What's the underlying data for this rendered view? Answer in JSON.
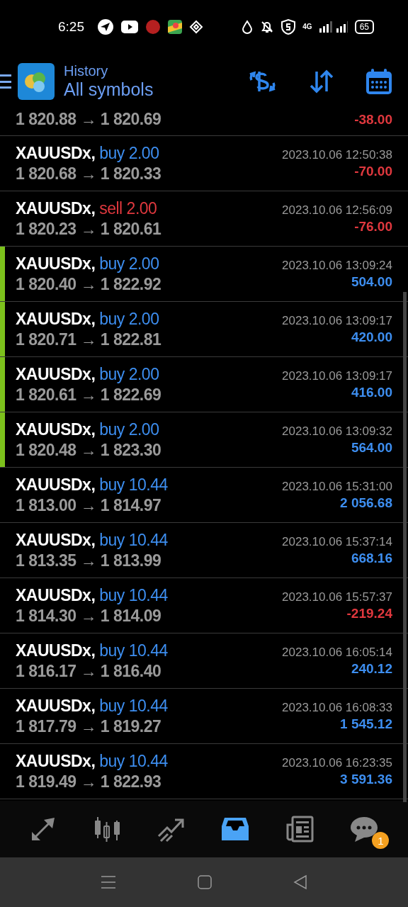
{
  "status_bar": {
    "time": "6:25",
    "network": "4G",
    "battery": "65"
  },
  "header": {
    "title": "History",
    "subtitle": "All symbols"
  },
  "partial_row": {
    "prices": "1 820.88 → 1 820.69",
    "profit": "-38.00",
    "loss": true
  },
  "trades": [
    {
      "symbol": "XAUUSDx,",
      "side": "buy",
      "volume": "2.00",
      "time": "2023.10.06 12:50:38",
      "prices": "1 820.68 → 1 820.33",
      "profit": "-70.00",
      "loss": true,
      "highlighted": false
    },
    {
      "symbol": "XAUUSDx,",
      "side": "sell",
      "volume": "2.00",
      "time": "2023.10.06 12:56:09",
      "prices": "1 820.23 → 1 820.61",
      "profit": "-76.00",
      "loss": true,
      "highlighted": false
    },
    {
      "symbol": "XAUUSDx,",
      "side": "buy",
      "volume": "2.00",
      "time": "2023.10.06 13:09:24",
      "prices": "1 820.40 → 1 822.92",
      "profit": "504.00",
      "loss": false,
      "highlighted": true
    },
    {
      "symbol": "XAUUSDx,",
      "side": "buy",
      "volume": "2.00",
      "time": "2023.10.06 13:09:17",
      "prices": "1 820.71 → 1 822.81",
      "profit": "420.00",
      "loss": false,
      "highlighted": true
    },
    {
      "symbol": "XAUUSDx,",
      "side": "buy",
      "volume": "2.00",
      "time": "2023.10.06 13:09:17",
      "prices": "1 820.61 → 1 822.69",
      "profit": "416.00",
      "loss": false,
      "highlighted": true
    },
    {
      "symbol": "XAUUSDx,",
      "side": "buy",
      "volume": "2.00",
      "time": "2023.10.06 13:09:32",
      "prices": "1 820.48 → 1 823.30",
      "profit": "564.00",
      "loss": false,
      "highlighted": true
    },
    {
      "symbol": "XAUUSDx,",
      "side": "buy",
      "volume": "10.44",
      "time": "2023.10.06 15:31:00",
      "prices": "1 813.00 → 1 814.97",
      "profit": "2 056.68",
      "loss": false,
      "highlighted": false
    },
    {
      "symbol": "XAUUSDx,",
      "side": "buy",
      "volume": "10.44",
      "time": "2023.10.06 15:37:14",
      "prices": "1 813.35 → 1 813.99",
      "profit": "668.16",
      "loss": false,
      "highlighted": false
    },
    {
      "symbol": "XAUUSDx,",
      "side": "buy",
      "volume": "10.44",
      "time": "2023.10.06 15:57:37",
      "prices": "1 814.30 → 1 814.09",
      "profit": "-219.24",
      "loss": true,
      "highlighted": false
    },
    {
      "symbol": "XAUUSDx,",
      "side": "buy",
      "volume": "10.44",
      "time": "2023.10.06 16:05:14",
      "prices": "1 816.17 → 1 816.40",
      "profit": "240.12",
      "loss": false,
      "highlighted": false
    },
    {
      "symbol": "XAUUSDx,",
      "side": "buy",
      "volume": "10.44",
      "time": "2023.10.06 16:08:33",
      "prices": "1 817.79 → 1 819.27",
      "profit": "1 545.12",
      "loss": false,
      "highlighted": false
    },
    {
      "symbol": "XAUUSDx,",
      "side": "buy",
      "volume": "10.44",
      "time": "2023.10.06 16:23:35",
      "prices": "1 819.49 → 1 822.93",
      "profit": "3 591.36",
      "loss": false,
      "highlighted": false
    }
  ],
  "bottom_nav": [
    {
      "kind": "quotes",
      "selected": false
    },
    {
      "kind": "chart",
      "selected": false
    },
    {
      "kind": "trade",
      "selected": false
    },
    {
      "kind": "history",
      "selected": true
    },
    {
      "kind": "news",
      "selected": false
    },
    {
      "kind": "messages",
      "selected": false,
      "badge": "1"
    }
  ]
}
